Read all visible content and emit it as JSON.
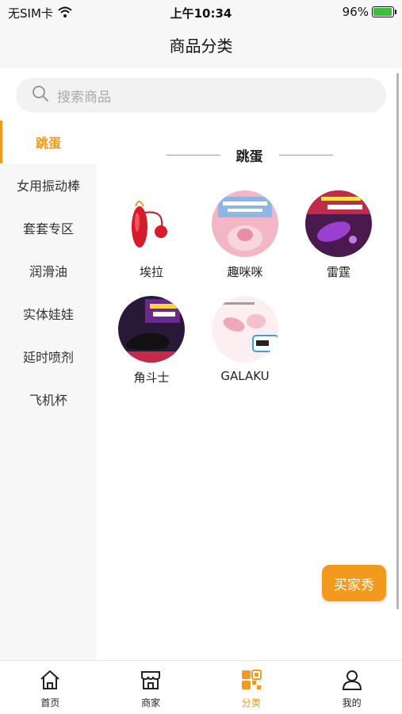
{
  "status_bar": {
    "carrier": "无SIM卡",
    "time": "上午10:34",
    "battery": "96%"
  },
  "nav": {
    "title": "商品分类"
  },
  "search": {
    "placeholder": "搜索商品"
  },
  "sidebar": {
    "items": [
      {
        "label": "跳蛋",
        "active": true
      },
      {
        "label": "女用振动棒",
        "active": false
      },
      {
        "label": "套套专区",
        "active": false
      },
      {
        "label": "润滑油",
        "active": false
      },
      {
        "label": "实体娃娃",
        "active": false
      },
      {
        "label": "延时喷剂",
        "active": false
      },
      {
        "label": "飞机杯",
        "active": false
      }
    ]
  },
  "content": {
    "section_title": "跳蛋",
    "items": [
      {
        "label": "埃拉",
        "icon": "red-egg-product-image"
      },
      {
        "label": "趣咪咪",
        "icon": "pink-product-poster-image"
      },
      {
        "label": "雷霆",
        "icon": "purple-product-poster-image"
      },
      {
        "label": "角斗士",
        "icon": "black-product-poster-image"
      },
      {
        "label": "GALAKU",
        "icon": "pink-egg-poster-image"
      }
    ]
  },
  "fab": {
    "label": "买家秀"
  },
  "tabs": [
    {
      "label": "首页",
      "icon": "home-icon",
      "active": false
    },
    {
      "label": "商家",
      "icon": "store-icon",
      "active": false
    },
    {
      "label": "分类",
      "icon": "category-grid-icon",
      "active": true
    },
    {
      "label": "我的",
      "icon": "user-icon",
      "active": false
    }
  ],
  "colors": {
    "accent": "#f39a1e",
    "sidebar_bg": "#f7f7f7",
    "search_bg": "#f2f2f2"
  }
}
